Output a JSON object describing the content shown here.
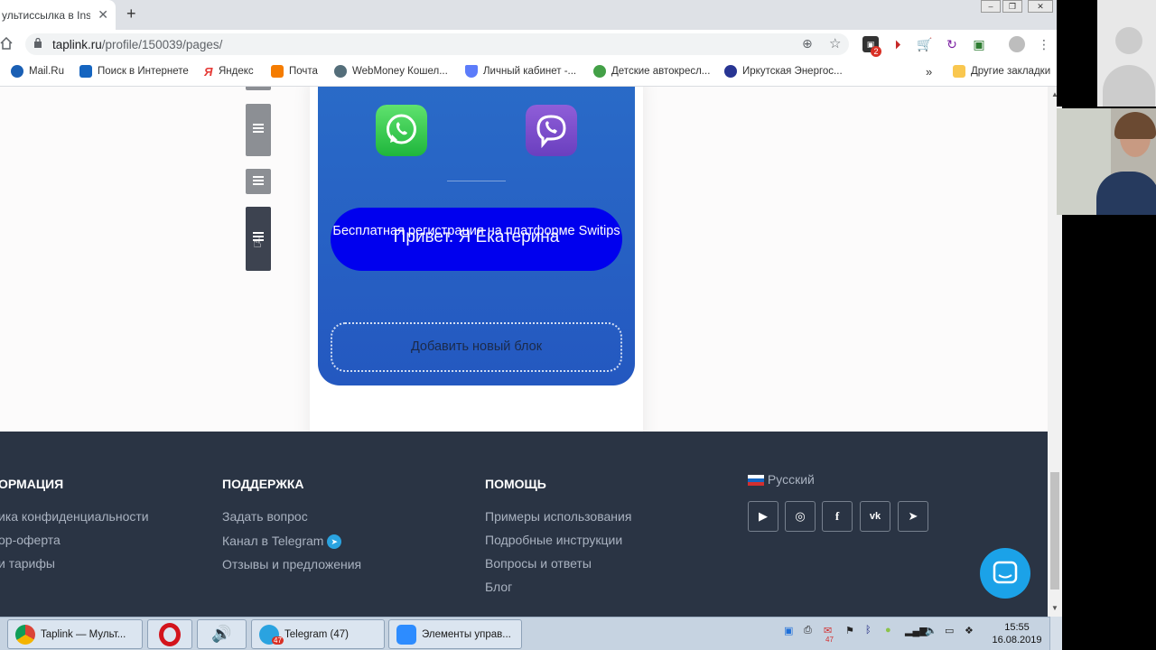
{
  "browser": {
    "tab_title": "ультиссылка в Insta",
    "url_host": "taplink.ru",
    "url_path": "/profile/150039/pages/",
    "bookmarks": [
      "Mail.Ru",
      "Поиск в Интернете",
      "Яндекс",
      "Почта",
      "WebMoney Кошел...",
      "Личный кабинет -...",
      "Детские автокресл...",
      "Иркутская Энергос..."
    ],
    "other_bookmarks": "Другие закладки",
    "ext_badge": "2",
    "overflow": "»"
  },
  "phone": {
    "reg_text": "Бесплатная регистрация на платформе Switips",
    "greeting": "Привет. Я Екатерина",
    "add_block": "Добавить новый блок"
  },
  "footer": {
    "columns": [
      {
        "heading": "ОРМАЦИЯ",
        "links": [
          "ика конфиденциальности",
          "ор-оферта",
          "и тарифы"
        ]
      },
      {
        "heading": "ПОДДЕРЖКА",
        "links": [
          "Задать вопрос",
          "Канал в Telegram",
          "Отзывы и предложения"
        ]
      },
      {
        "heading": "ПОМОЩЬ",
        "links": [
          "Примеры использования",
          "Подробные инструкции",
          "Вопросы и ответы",
          "Блог"
        ]
      }
    ],
    "language": "Русский",
    "social": [
      "youtube-icon",
      "instagram-icon",
      "facebook-icon",
      "vk-icon",
      "telegram-icon"
    ]
  },
  "taskbar": {
    "items": [
      "Taplink — Мульт...",
      "Telegram (47)",
      "Элементы управ..."
    ],
    "telegram_badge": "47",
    "tray_badge": "47",
    "time": "15:55",
    "date": "16.08.2019"
  },
  "colors": {
    "footer_bg": "#2a3444",
    "reg_button": "#0000ee",
    "screen_blue": "#2a6cc8",
    "chat_blue": "#1ba2e8"
  }
}
